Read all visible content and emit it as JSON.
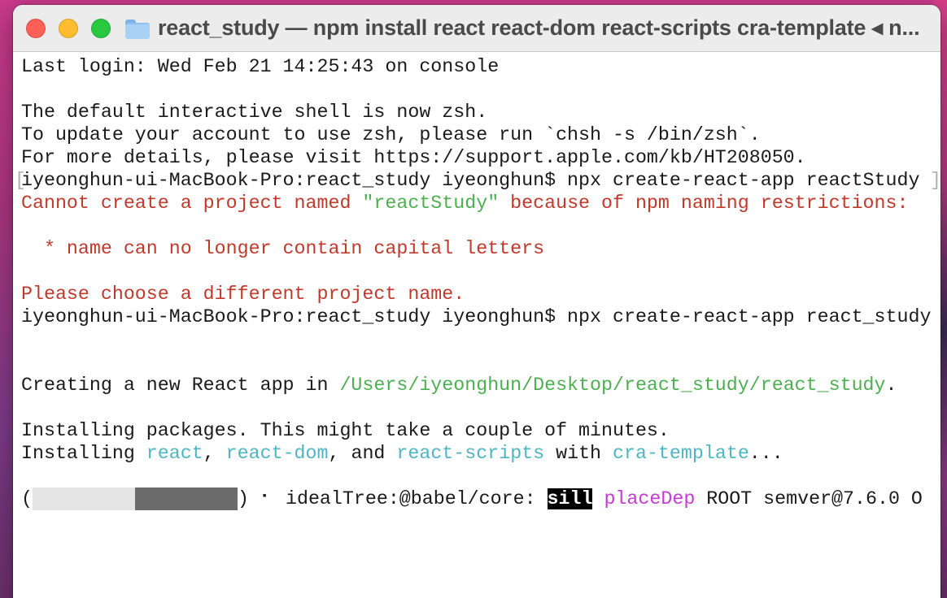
{
  "window": {
    "title": "react_study — npm install react react-dom react-scripts cra-template ◂ n..."
  },
  "progress": {
    "filled_fraction": 0.5
  },
  "terminal": {
    "line1": "Last login: Wed Feb 21 14:25:43 on console",
    "line3": "The default interactive shell is now zsh.",
    "line4": "To update your account to use zsh, please run `chsh -s /bin/zsh`.",
    "line5": "For more details, please visit https://support.apple.com/kb/HT208050.",
    "line6_prompt": "iyeonghun-ui-MacBook-Pro:react_study iyeonghun$ npx create-react-app reactStudy",
    "line6_bracket_left": "[",
    "line6_bracket_right": "]",
    "line7_a": "Cannot create a project named ",
    "line7_b": "\"reactStudy\"",
    "line7_c": " because of npm naming restrictions:",
    "line9": "  * name can no longer contain capital letters",
    "line11": "Please choose a different project name.",
    "line12_prompt": "iyeonghun-ui-MacBook-Pro:react_study iyeonghun$ npx create-react-app react_study",
    "line15_a": "Creating a new React app in ",
    "line15_b": "/Users/iyeonghun/Desktop/react_study/react_study",
    "line15_c": ".",
    "line17": "Installing packages. This might take a couple of minutes.",
    "line18_a": "Installing ",
    "line18_b": "react",
    "line18_c": ", ",
    "line18_d": "react-dom",
    "line18_e": ", and ",
    "line18_f": "react-scripts",
    "line18_g": " with ",
    "line18_h": "cra-template",
    "line18_i": "...",
    "line20_open": "(",
    "line20_close": ")",
    "line20_spinner": " ⠂ idealTree:@babel/core: ",
    "line20_sill": "sill",
    "line20_space": " ",
    "line20_placedep": "placeDep",
    "line20_rest": " ROOT semver@7.6.0 O"
  }
}
